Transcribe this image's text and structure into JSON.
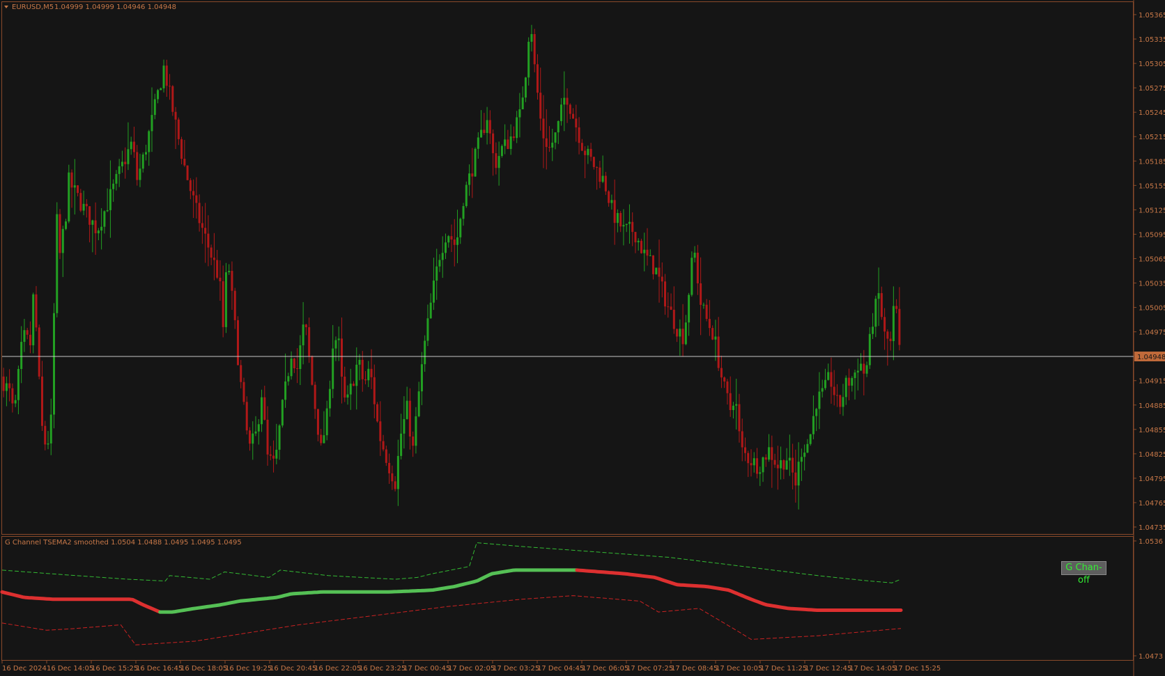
{
  "header": {
    "symbol": "EURUSD,M5",
    "ohlc": "1.04999 1.04999 1.04946 1.04948"
  },
  "indicator": {
    "label": "G Channel TSEMA2 smoothed 1.0504 1.0488 1.0495 1.0495 1.0495",
    "button": "G Chan-off"
  },
  "colors": {
    "bull": "#22a022",
    "bear": "#b01818",
    "frame": "#8a4a2a",
    "text": "#c87848",
    "price_line": "#c8c8c8",
    "ma_up": "#55c055",
    "ma_down": "#dd3030",
    "upper_band": "#33bb33",
    "lower_band": "#cc2222",
    "background": "#151515"
  },
  "chart_data": [
    {
      "type": "candlestick",
      "title": "EURUSD,M5",
      "ylim": [
        1.0472,
        1.0538
      ],
      "yticks": [
        "1.05365",
        "1.05335",
        "1.05305",
        "1.05275",
        "1.05245",
        "1.05215",
        "1.05185",
        "1.05155",
        "1.05125",
        "1.05095",
        "1.05065",
        "1.05035",
        "1.05005",
        "1.04975",
        "1.04915",
        "1.04885",
        "1.04855",
        "1.04825",
        "1.04795",
        "1.04765",
        "1.04735"
      ],
      "current_price": "1.04948",
      "xticks": [
        "16 Dec 2024",
        "16 Dec 14:05",
        "16 Dec 15:25",
        "16 Dec 16:45",
        "16 Dec 18:05",
        "16 Dec 19:25",
        "16 Dec 20:45",
        "16 Dec 22:05",
        "16 Dec 23:25",
        "17 Dec 00:45",
        "17 Dec 02:05",
        "17 Dec 03:25",
        "17 Dec 04:45",
        "17 Dec 06:05",
        "17 Dec 07:25",
        "17 Dec 08:45",
        "17 Dec 10:05",
        "17 Dec 11:25",
        "17 Dec 12:45",
        "17 Dec 14:05",
        "17 Dec 15:25"
      ],
      "bars": 303,
      "price_path": [
        [
          0,
          1.0492
        ],
        [
          12,
          1.049
        ],
        [
          18,
          1.0487
        ],
        [
          30,
          1.0497
        ],
        [
          40,
          1.0496
        ],
        [
          45,
          1.0503
        ],
        [
          55,
          1.0486
        ],
        [
          62,
          1.0483
        ],
        [
          69,
          1.0487
        ],
        [
          75,
          1.0512
        ],
        [
          80,
          1.0507
        ],
        [
          88,
          1.0512
        ],
        [
          92,
          1.0516
        ],
        [
          110,
          1.0513
        ],
        [
          130,
          1.051
        ],
        [
          160,
          1.0517
        ],
        [
          178,
          1.0521
        ],
        [
          183,
          1.0516
        ],
        [
          190,
          1.0518
        ],
        [
          198,
          1.0521
        ],
        [
          220,
          1.053
        ],
        [
          225,
          1.0528
        ],
        [
          238,
          1.0522
        ],
        [
          250,
          1.0517
        ],
        [
          265,
          1.0512
        ],
        [
          280,
          1.0508
        ],
        [
          295,
          1.0504
        ],
        [
          300,
          1.0498
        ],
        [
          304,
          1.0504
        ],
        [
          306,
          1.0507
        ],
        [
          315,
          1.0499
        ],
        [
          325,
          1.049
        ],
        [
          335,
          1.0483
        ],
        [
          345,
          1.0485
        ],
        [
          352,
          1.049
        ],
        [
          360,
          1.0482
        ],
        [
          370,
          1.0481
        ],
        [
          378,
          1.0487
        ],
        [
          392,
          1.0495
        ],
        [
          400,
          1.0493
        ],
        [
          410,
          1.0499
        ],
        [
          420,
          1.0491
        ],
        [
          432,
          1.0483
        ],
        [
          440,
          1.0487
        ],
        [
          448,
          1.0496
        ],
        [
          455,
          1.0497
        ],
        [
          462,
          1.0489
        ],
        [
          468,
          1.0489
        ],
        [
          482,
          1.0494
        ],
        [
          490,
          1.0491
        ],
        [
          498,
          1.0493
        ],
        [
          510,
          1.0485
        ],
        [
          524,
          1.0481
        ],
        [
          532,
          1.0479
        ],
        [
          540,
          1.0485
        ],
        [
          548,
          1.0488
        ],
        [
          556,
          1.0483
        ],
        [
          564,
          1.049
        ],
        [
          572,
          1.0496
        ],
        [
          582,
          1.0502
        ],
        [
          592,
          1.0507
        ],
        [
          602,
          1.051
        ],
        [
          614,
          1.0508
        ],
        [
          624,
          1.0514
        ],
        [
          634,
          1.0517
        ],
        [
          646,
          1.0521
        ],
        [
          656,
          1.0524
        ],
        [
          666,
          1.0518
        ],
        [
          676,
          1.052
        ],
        [
          686,
          1.0521
        ],
        [
          700,
          1.0524
        ],
        [
          710,
          1.0531
        ],
        [
          714,
          1.0537
        ],
        [
          720,
          1.053
        ],
        [
          730,
          1.0522
        ],
        [
          740,
          1.052
        ],
        [
          750,
          1.0522
        ],
        [
          762,
          1.0527
        ],
        [
          772,
          1.0524
        ],
        [
          786,
          1.052
        ],
        [
          800,
          1.0518
        ],
        [
          814,
          1.0516
        ],
        [
          826,
          1.0512
        ],
        [
          840,
          1.051
        ],
        [
          854,
          1.051
        ],
        [
          868,
          1.0507
        ],
        [
          884,
          1.0505
        ],
        [
          898,
          1.0501
        ],
        [
          912,
          1.0498
        ],
        [
          920,
          1.0497
        ],
        [
          926,
          1.05
        ],
        [
          930,
          1.0505
        ],
        [
          936,
          1.0507
        ],
        [
          944,
          1.0501
        ],
        [
          952,
          1.0499
        ],
        [
          962,
          1.0497
        ],
        [
          974,
          1.0491
        ],
        [
          984,
          1.0488
        ],
        [
          990,
          1.049
        ],
        [
          998,
          1.0483
        ],
        [
          1008,
          1.0482
        ],
        [
          1022,
          1.0481
        ],
        [
          1036,
          1.0483
        ],
        [
          1048,
          1.0481
        ],
        [
          1060,
          1.0482
        ],
        [
          1072,
          1.0479
        ],
        [
          1080,
          1.0483
        ],
        [
          1090,
          1.0484
        ],
        [
          1100,
          1.0489
        ],
        [
          1110,
          1.049
        ],
        [
          1118,
          1.0492
        ],
        [
          1130,
          1.0488
        ],
        [
          1140,
          1.0491
        ],
        [
          1150,
          1.0492
        ],
        [
          1158,
          1.0494
        ],
        [
          1166,
          1.0492
        ],
        [
          1176,
          1.0499
        ],
        [
          1184,
          1.0502
        ],
        [
          1192,
          1.0497
        ],
        [
          1200,
          1.0496
        ],
        [
          1206,
          1.0502
        ],
        [
          1212,
          1.0495
        ]
      ]
    },
    {
      "type": "line",
      "title": "G Channel TSEMA2 smoothed",
      "ylim": [
        1.0473,
        1.0536
      ],
      "yticks": [
        "1.0536",
        "1.0473"
      ],
      "series": [
        {
          "role": "upper_band",
          "style": "dashed",
          "values": [
            [
              0,
              1.052
            ],
            [
              100,
              1.0517
            ],
            [
              170,
              1.0515
            ],
            [
              220,
              1.0514
            ],
            [
              226,
              1.0517
            ],
            [
              280,
              1.0515
            ],
            [
              300,
              1.0519
            ],
            [
              360,
              1.0516
            ],
            [
              375,
              1.052
            ],
            [
              440,
              1.0517
            ],
            [
              530,
              1.0515
            ],
            [
              560,
              1.0516
            ],
            [
              580,
              1.0518
            ],
            [
              630,
              1.0522
            ],
            [
              640,
              1.0535
            ],
            [
              700,
              1.0533
            ],
            [
              800,
              1.053
            ],
            [
              900,
              1.0527
            ],
            [
              1000,
              1.0522
            ],
            [
              1100,
              1.0517
            ],
            [
              1170,
              1.0514
            ],
            [
              1200,
              1.0513
            ],
            [
              1212,
              1.0515
            ]
          ]
        },
        {
          "role": "lower_band",
          "style": "dashed",
          "values": [
            [
              0,
              1.0491
            ],
            [
              30,
              1.0489
            ],
            [
              60,
              1.0487
            ],
            [
              100,
              1.0488
            ],
            [
              160,
              1.049
            ],
            [
              180,
              1.0479
            ],
            [
              260,
              1.0481
            ],
            [
              400,
              1.049
            ],
            [
              600,
              1.05
            ],
            [
              700,
              1.0504
            ],
            [
              770,
              1.0506
            ],
            [
              800,
              1.0505
            ],
            [
              860,
              1.0503
            ],
            [
              885,
              1.0497
            ],
            [
              940,
              1.0499
            ],
            [
              990,
              1.0487
            ],
            [
              1010,
              1.0482
            ],
            [
              1100,
              1.0484
            ],
            [
              1212,
              1.0488
            ]
          ]
        },
        {
          "role": "smoothed_ma",
          "style": "solid",
          "values": [
            [
              0,
              1.0508
            ],
            [
              30,
              1.0505
            ],
            [
              70,
              1.0504
            ],
            [
              175,
              1.0504
            ],
            [
              190,
              1.0501
            ],
            [
              213,
              1.0497
            ],
            [
              230,
              1.0497
            ],
            [
              260,
              1.0499
            ],
            [
              295,
              1.0501
            ],
            [
              320,
              1.0503
            ],
            [
              370,
              1.0505
            ],
            [
              390,
              1.0507
            ],
            [
              430,
              1.0508
            ],
            [
              520,
              1.0508
            ],
            [
              580,
              1.0509
            ],
            [
              610,
              1.0511
            ],
            [
              640,
              1.0514
            ],
            [
              660,
              1.0518
            ],
            [
              690,
              1.052
            ],
            [
              775,
              1.052
            ],
            [
              840,
              1.0518
            ],
            [
              880,
              1.0516
            ],
            [
              910,
              1.0512
            ],
            [
              950,
              1.0511
            ],
            [
              980,
              1.0509
            ],
            [
              1010,
              1.0504
            ],
            [
              1030,
              1.0501
            ],
            [
              1060,
              1.0499
            ],
            [
              1100,
              1.0498
            ],
            [
              1212,
              1.0498
            ]
          ],
          "color_segments": [
            [
              0,
              213,
              "down"
            ],
            [
              213,
              775,
              "up"
            ],
            [
              775,
              1212,
              "down"
            ]
          ]
        }
      ]
    }
  ]
}
